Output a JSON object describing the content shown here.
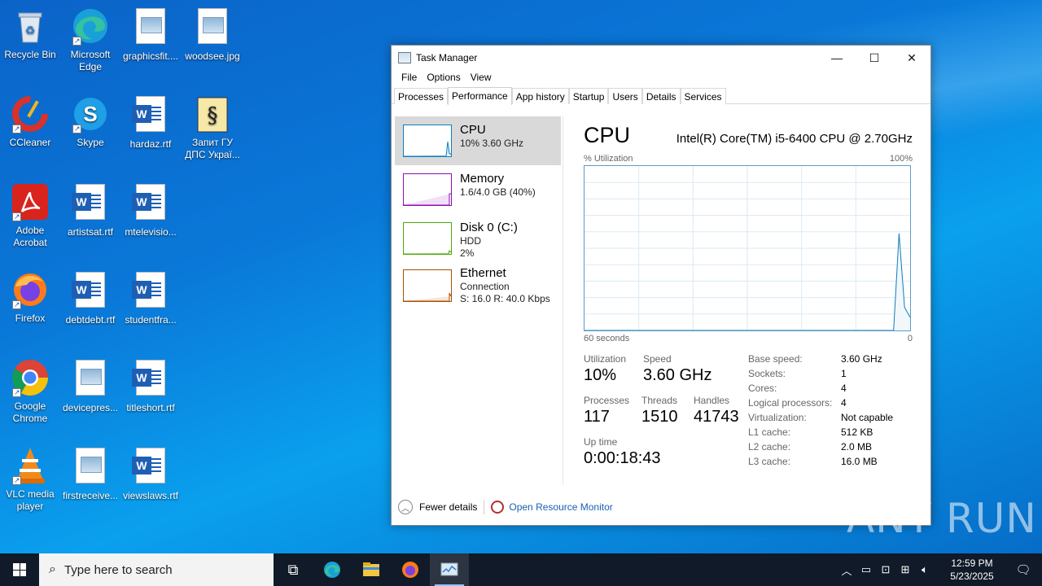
{
  "desktop": {
    "icons": [
      {
        "label": "Recycle Bin",
        "icon": "recycle-bin-icon"
      },
      {
        "label": "Microsoft Edge",
        "icon": "edge-icon"
      },
      {
        "label": "graphicsfit....",
        "icon": "image-file-icon"
      },
      {
        "label": "woodsee.jpg",
        "icon": "image-file-icon"
      },
      {
        "label": "CCleaner",
        "icon": "ccleaner-icon"
      },
      {
        "label": "Skype",
        "icon": "skype-icon"
      },
      {
        "label": "hardaz.rtf",
        "icon": "word-doc-icon"
      },
      {
        "label": "Запит ГУ ДПС Украї...",
        "icon": "script-file-icon"
      },
      {
        "label": "Adobe Acrobat",
        "icon": "acrobat-icon"
      },
      {
        "label": "artistsat.rtf",
        "icon": "word-doc-icon"
      },
      {
        "label": "mtelevisio...",
        "icon": "word-doc-icon"
      },
      {
        "label": "Firefox",
        "icon": "firefox-icon"
      },
      {
        "label": "debtdebt.rtf",
        "icon": "word-doc-icon"
      },
      {
        "label": "studentfra...",
        "icon": "word-doc-icon"
      },
      {
        "label": "Google Chrome",
        "icon": "chrome-icon"
      },
      {
        "label": "devicepres...",
        "icon": "image-file-icon"
      },
      {
        "label": "titleshort.rtf",
        "icon": "word-doc-icon"
      },
      {
        "label": "VLC media player",
        "icon": "vlc-icon"
      },
      {
        "label": "firstreceive...",
        "icon": "image-file-icon"
      },
      {
        "label": "viewslaws.rtf",
        "icon": "word-doc-icon"
      }
    ]
  },
  "window": {
    "title": "Task Manager",
    "controls": {
      "minimize": "—",
      "maximize": "☐",
      "close": "✕"
    },
    "menu": [
      "File",
      "Options",
      "View"
    ],
    "tabs": [
      "Processes",
      "Performance",
      "App history",
      "Startup",
      "Users",
      "Details",
      "Services"
    ],
    "active_tab": "Performance"
  },
  "resources": [
    {
      "name": "CPU",
      "line1": "10% 3.60 GHz",
      "line2": "",
      "color": "#117dbb"
    },
    {
      "name": "Memory",
      "line1": "1.6/4.0 GB (40%)",
      "line2": "",
      "color": "#8b12ae"
    },
    {
      "name": "Disk 0 (C:)",
      "line1": "HDD",
      "line2": "2%",
      "color": "#4da60c"
    },
    {
      "name": "Ethernet",
      "line1": "Connection",
      "line2": "S: 16.0  R: 40.0 Kbps",
      "color": "#a74f01"
    }
  ],
  "cpu_panel": {
    "heading": "CPU",
    "model": "Intel(R) Core(TM) i5-6400 CPU @ 2.70GHz",
    "graph_label_left": "% Utilization",
    "graph_label_right": "100%",
    "graph_bottom_left": "60 seconds",
    "graph_bottom_right": "0",
    "utilization_history": [
      0,
      0,
      0,
      0,
      0,
      0,
      0,
      0,
      0,
      0,
      0,
      0,
      0,
      0,
      0,
      0,
      0,
      0,
      0,
      0,
      0,
      0,
      0,
      0,
      0,
      0,
      0,
      0,
      0,
      0,
      0,
      0,
      0,
      0,
      0,
      0,
      0,
      0,
      0,
      0,
      0,
      0,
      0,
      0,
      0,
      0,
      0,
      0,
      0,
      0,
      0,
      0,
      0,
      0,
      0,
      0,
      0,
      59,
      14,
      8
    ],
    "stats": {
      "utilization_label": "Utilization",
      "utilization": "10%",
      "speed_label": "Speed",
      "speed": "3.60 GHz",
      "processes_label": "Processes",
      "processes": "117",
      "threads_label": "Threads",
      "threads": "1510",
      "handles_label": "Handles",
      "handles": "41743",
      "uptime_label": "Up time",
      "uptime": "0:00:18:43"
    },
    "specs": [
      {
        "k": "Base speed:",
        "v": "3.60 GHz"
      },
      {
        "k": "Sockets:",
        "v": "1"
      },
      {
        "k": "Cores:",
        "v": "4"
      },
      {
        "k": "Logical processors:",
        "v": "4"
      },
      {
        "k": "Virtualization:",
        "v": "Not capable"
      },
      {
        "k": "L1 cache:",
        "v": "512 KB"
      },
      {
        "k": "L2 cache:",
        "v": "2.0 MB"
      },
      {
        "k": "L3 cache:",
        "v": "16.0 MB"
      }
    ]
  },
  "footer": {
    "fewer_details": "Fewer details",
    "open_resource_monitor": "Open Resource Monitor"
  },
  "watermark": "ANY RUN",
  "taskbar": {
    "search_placeholder": "Type here to search",
    "time": "12:59 PM",
    "date": "5/23/2025"
  }
}
